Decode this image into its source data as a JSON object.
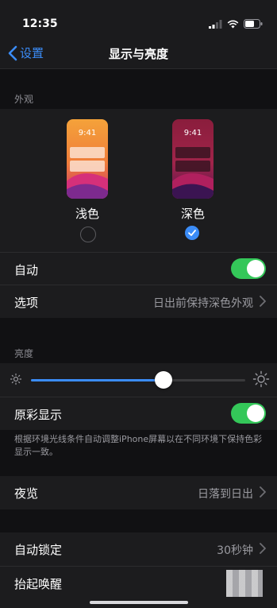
{
  "status_bar": {
    "time": "12:35"
  },
  "nav": {
    "back_label": "设置",
    "title": "显示与亮度"
  },
  "appearance": {
    "section_label": "外观",
    "light": {
      "preview_time": "9:41",
      "label": "浅色",
      "selected": false
    },
    "dark": {
      "preview_time": "9:41",
      "label": "深色",
      "selected": true
    },
    "auto": {
      "label": "自动",
      "on": true
    },
    "options": {
      "label": "选项",
      "value": "日出前保持深色外观"
    }
  },
  "brightness": {
    "section_label": "亮度",
    "level": 0.62,
    "true_tone": {
      "label": "原彩显示",
      "on": true
    },
    "footnote": "根据环境光线条件自动调整iPhone屏幕以在不同环境下保持色彩显示一致。"
  },
  "night_shift": {
    "label": "夜览",
    "value": "日落到日出"
  },
  "lock": {
    "auto_lock": {
      "label": "自动锁定",
      "value": "30秒钟"
    },
    "raise_to_wake": {
      "label": "抬起唤醒"
    }
  },
  "colors": {
    "accent": "#3b8cf7",
    "toggle_on": "#34c759",
    "group_bg": "#1c1c1e",
    "page_bg": "#111113"
  },
  "icons": [
    "signal-icon",
    "wifi-icon",
    "battery-icon",
    "chevron-left-icon",
    "chevron-right-icon",
    "sun-small-icon",
    "sun-large-icon",
    "checkmark-icon"
  ]
}
